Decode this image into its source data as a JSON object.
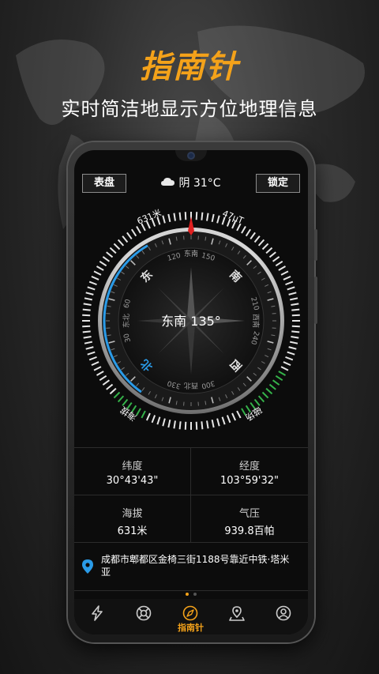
{
  "promo": {
    "headline": "指南针",
    "subline": "实时简洁地显示方位地理信息"
  },
  "app": {
    "left_button": "表盘",
    "right_button": "锁定",
    "weather": {
      "icon": "cloud-icon",
      "text": "阴 31°C"
    },
    "compass": {
      "heading_text": "东南 135°",
      "altitude_arc_label": "631米",
      "magnetic_arc_label": "47μT",
      "altitude_label": "海拔",
      "magnetic_label": "磁场",
      "direction_label": "东南",
      "cardinals": [
        "东",
        "南",
        "西",
        "北"
      ],
      "intercardinals": [
        "东北",
        "东南",
        "西南",
        "西北"
      ],
      "degree_labels": [
        "0",
        "30",
        "60",
        "90",
        "120",
        "150",
        "180",
        "210",
        "240",
        "270",
        "300",
        "330"
      ],
      "heading_deg": 135,
      "colors": {
        "accent_blue": "#2a9be8",
        "accent_green": "#35b34a",
        "needle_red": "#e02020"
      }
    },
    "info": {
      "latitude_label": "纬度",
      "latitude_value": "30°43'43\"",
      "longitude_label": "经度",
      "longitude_value": "103°59'32\"",
      "altitude_label": "海拔",
      "altitude_value": "631米",
      "pressure_label": "气压",
      "pressure_value": "939.8百帕"
    },
    "address": "成都市郫都区金椅三街1188号靠近中铁·塔米亚",
    "nav": {
      "items": [
        {
          "icon": "lightning-icon",
          "label": ""
        },
        {
          "icon": "lifebuoy-icon",
          "label": ""
        },
        {
          "icon": "compass-icon",
          "label": "指南针"
        },
        {
          "icon": "map-pin-icon",
          "label": ""
        },
        {
          "icon": "user-icon",
          "label": ""
        }
      ],
      "active_color": "#f4a21a"
    }
  }
}
